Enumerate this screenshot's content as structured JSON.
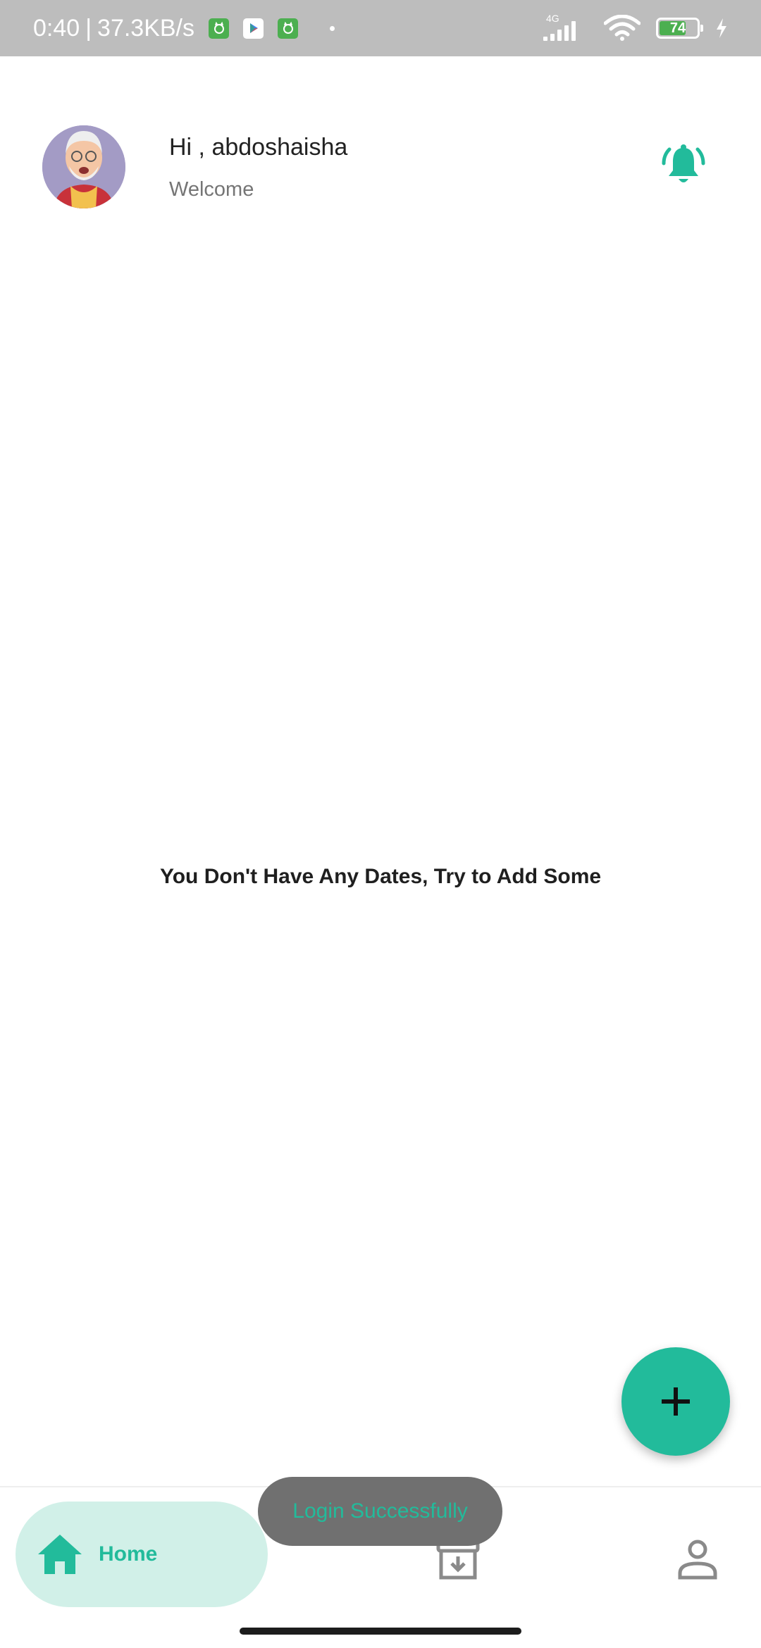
{
  "status_bar": {
    "time": "0:40",
    "separator": "|",
    "network_speed": "37.3KB/s",
    "network_type": "4G",
    "battery_level": "74",
    "battery_fraction": 0.74,
    "icons": [
      "cat-app-icon",
      "play-store-icon",
      "cat-app-icon",
      "notification-dot",
      "signal-icon",
      "wifi-icon",
      "battery-icon",
      "charging-icon"
    ]
  },
  "header": {
    "greeting": "Hi , abdoshaisha",
    "subtitle": "Welcome",
    "notification_icon": "bell-ringing-icon"
  },
  "main": {
    "empty_message": "You Don't Have Any Dates, Try to Add Some"
  },
  "fab": {
    "icon": "plus-icon"
  },
  "bottom_nav": {
    "items": [
      {
        "label": "Home",
        "icon": "home-icon",
        "selected": true
      },
      {
        "label": "",
        "icon": "archive-icon",
        "selected": false
      },
      {
        "label": "",
        "icon": "profile-icon",
        "selected": false
      }
    ]
  },
  "toast": {
    "message": "Login Successfully"
  },
  "colors": {
    "accent": "#22bb9b",
    "accent_light": "#d1f0e8",
    "status_bar": "#bdbdbd",
    "text_primary": "#222222",
    "text_secondary": "#757575",
    "nav_inactive": "#8a8a8a",
    "toast_bg": "#707070"
  }
}
